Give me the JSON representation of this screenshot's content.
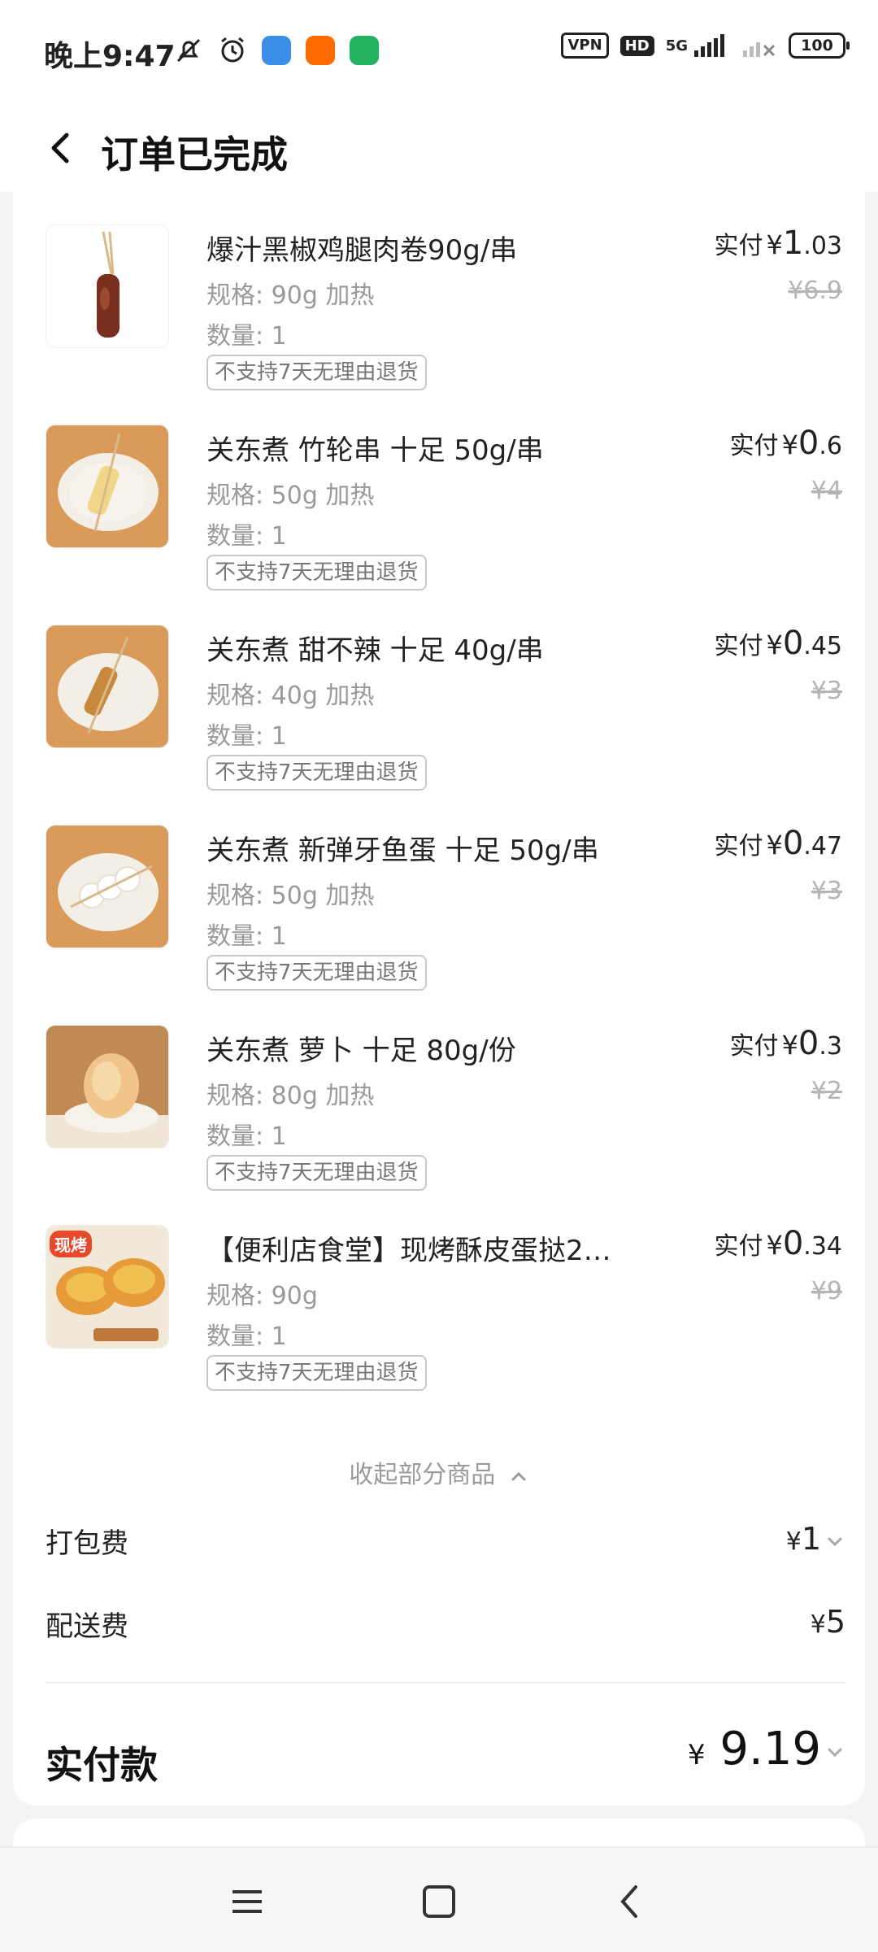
{
  "status_bar": {
    "time": "晚上9:47",
    "vpn": "VPN",
    "hd": "HD",
    "network": "5G",
    "battery": "100"
  },
  "header": {
    "title": "订单已完成"
  },
  "items": [
    {
      "name": "爆汁黑椒鸡腿肉卷90g/串",
      "spec": "规格: 90g 加热",
      "qty": "数量: 1",
      "tag": "不支持7天无理由退货",
      "paid_label": "实付",
      "currency": "¥",
      "paid_int": "1",
      "paid_dec": ".03",
      "orig": "¥6.9",
      "image": "chicken-skewer-image"
    },
    {
      "name": "关东煮 竹轮串 十足 50g/串",
      "spec": "规格: 50g 加热",
      "qty": "数量: 1",
      "tag": "不支持7天无理由退货",
      "paid_label": "实付",
      "currency": "¥",
      "paid_int": "0",
      "paid_dec": ".6",
      "orig": "¥4",
      "image": "fishcake-skewer-image"
    },
    {
      "name": "关东煮 甜不辣 十足 40g/串",
      "spec": "规格: 40g 加热",
      "qty": "数量: 1",
      "tag": "不支持7天无理由退货",
      "paid_label": "实付",
      "currency": "¥",
      "paid_int": "0",
      "paid_dec": ".45",
      "orig": "¥3",
      "image": "tempura-skewer-image"
    },
    {
      "name": "关东煮 新弹牙鱼蛋 十足 50g/串",
      "spec": "规格: 50g 加热",
      "qty": "数量: 1",
      "tag": "不支持7天无理由退货",
      "paid_label": "实付",
      "currency": "¥",
      "paid_int": "0",
      "paid_dec": ".47",
      "orig": "¥3",
      "image": "fishball-skewer-image"
    },
    {
      "name": "关东煮 萝卜 十足 80g/份",
      "spec": "规格: 80g 加热",
      "qty": "数量: 1",
      "tag": "不支持7天无理由退货",
      "paid_label": "实付",
      "currency": "¥",
      "paid_int": "0",
      "paid_dec": ".3",
      "orig": "¥2",
      "image": "radish-image"
    },
    {
      "name": "【便利店食堂】现烤酥皮蛋挞2…",
      "spec": "规格: 90g",
      "qty": "数量: 1",
      "tag": "不支持7天无理由退货",
      "paid_label": "实付",
      "currency": "¥",
      "paid_int": "0",
      "paid_dec": ".34",
      "orig": "¥9",
      "image": "egg-tart-image",
      "image_badge": "现烤"
    }
  ],
  "collapse_label": "收起部分商品",
  "fees": {
    "packing_label": "打包费",
    "packing_value": "1",
    "delivery_label": "配送费",
    "delivery_value": "5",
    "currency": "¥"
  },
  "total": {
    "label": "实付款",
    "currency": "¥",
    "value": "9.19"
  },
  "colors": {
    "background": "#f4f4f4",
    "card": "#ffffff",
    "muted_text": "#9a9a9a",
    "strike_text": "#b5b5b5"
  }
}
